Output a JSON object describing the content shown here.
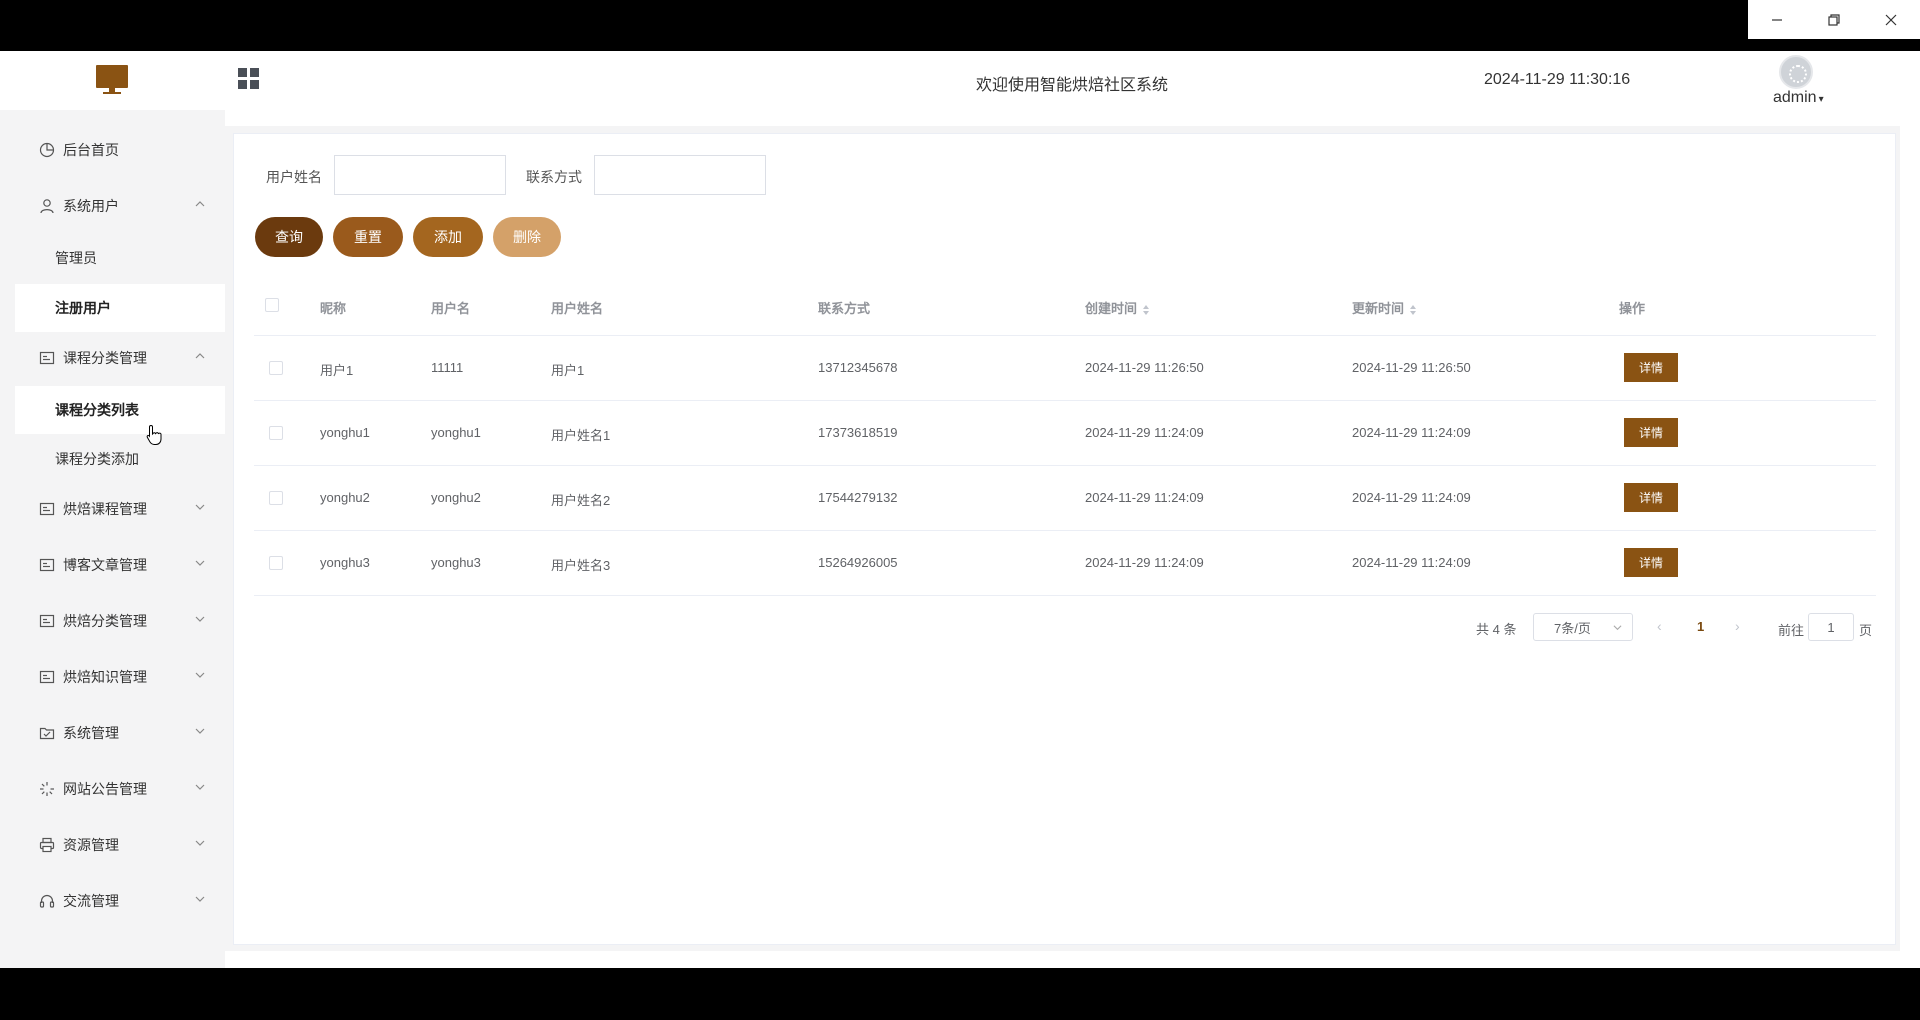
{
  "header": {
    "welcome": "欢迎使用智能烘焙社区系统",
    "datetime": "2024-11-29 11:30:16",
    "user": "admin",
    "brand_color": "#8a5313"
  },
  "sidebar": {
    "items": [
      {
        "label": "后台首页",
        "icon": "pie-chart-icon"
      },
      {
        "label": "系统用户",
        "icon": "user-icon",
        "expanded": true
      },
      {
        "label": "管理员"
      },
      {
        "label": "注册用户",
        "active": true
      },
      {
        "label": "课程分类管理",
        "icon": "list-icon",
        "expanded": true
      },
      {
        "label": "课程分类列表",
        "active": true
      },
      {
        "label": "课程分类添加"
      },
      {
        "label": "烘焙课程管理",
        "icon": "list-icon"
      },
      {
        "label": "博客文章管理",
        "icon": "list-icon"
      },
      {
        "label": "烘焙分类管理",
        "icon": "list-icon"
      },
      {
        "label": "烘焙知识管理",
        "icon": "list-icon"
      },
      {
        "label": "系统管理",
        "icon": "checkbox-icon"
      },
      {
        "label": "网站公告管理",
        "icon": "loading-icon"
      },
      {
        "label": "资源管理",
        "icon": "printer-icon"
      },
      {
        "label": "交流管理",
        "icon": "headset-icon"
      }
    ]
  },
  "search": {
    "name_label": "用户姓名",
    "name_value": "",
    "contact_label": "联系方式",
    "contact_value": ""
  },
  "buttons": {
    "query": "查询",
    "reset": "重置",
    "add": "添加",
    "delete": "删除"
  },
  "table": {
    "columns": [
      "昵称",
      "用户名",
      "用户姓名",
      "联系方式",
      "创建时间",
      "更新时间",
      "操作"
    ],
    "rows": [
      {
        "nickname": "用户1",
        "username": "11111",
        "realname": "用户1",
        "contact": "13712345678",
        "created": "2024-11-29 11:26:50",
        "updated": "2024-11-29 11:26:50",
        "action": "详情"
      },
      {
        "nickname": "yonghu1",
        "username": "yonghu1",
        "realname": "用户姓名1",
        "contact": "17373618519",
        "created": "2024-11-29 11:24:09",
        "updated": "2024-11-29 11:24:09",
        "action": "详情"
      },
      {
        "nickname": "yonghu2",
        "username": "yonghu2",
        "realname": "用户姓名2",
        "contact": "17544279132",
        "created": "2024-11-29 11:24:09",
        "updated": "2024-11-29 11:24:09",
        "action": "详情"
      },
      {
        "nickname": "yonghu3",
        "username": "yonghu3",
        "realname": "用户姓名3",
        "contact": "15264926005",
        "created": "2024-11-29 11:24:09",
        "updated": "2024-11-29 11:24:09",
        "action": "详情"
      }
    ]
  },
  "pagination": {
    "total": "共 4 条",
    "page_size": "7条/页",
    "current_page": "1",
    "goto_label": "前往",
    "goto_value": "1",
    "page_suffix": "页"
  }
}
